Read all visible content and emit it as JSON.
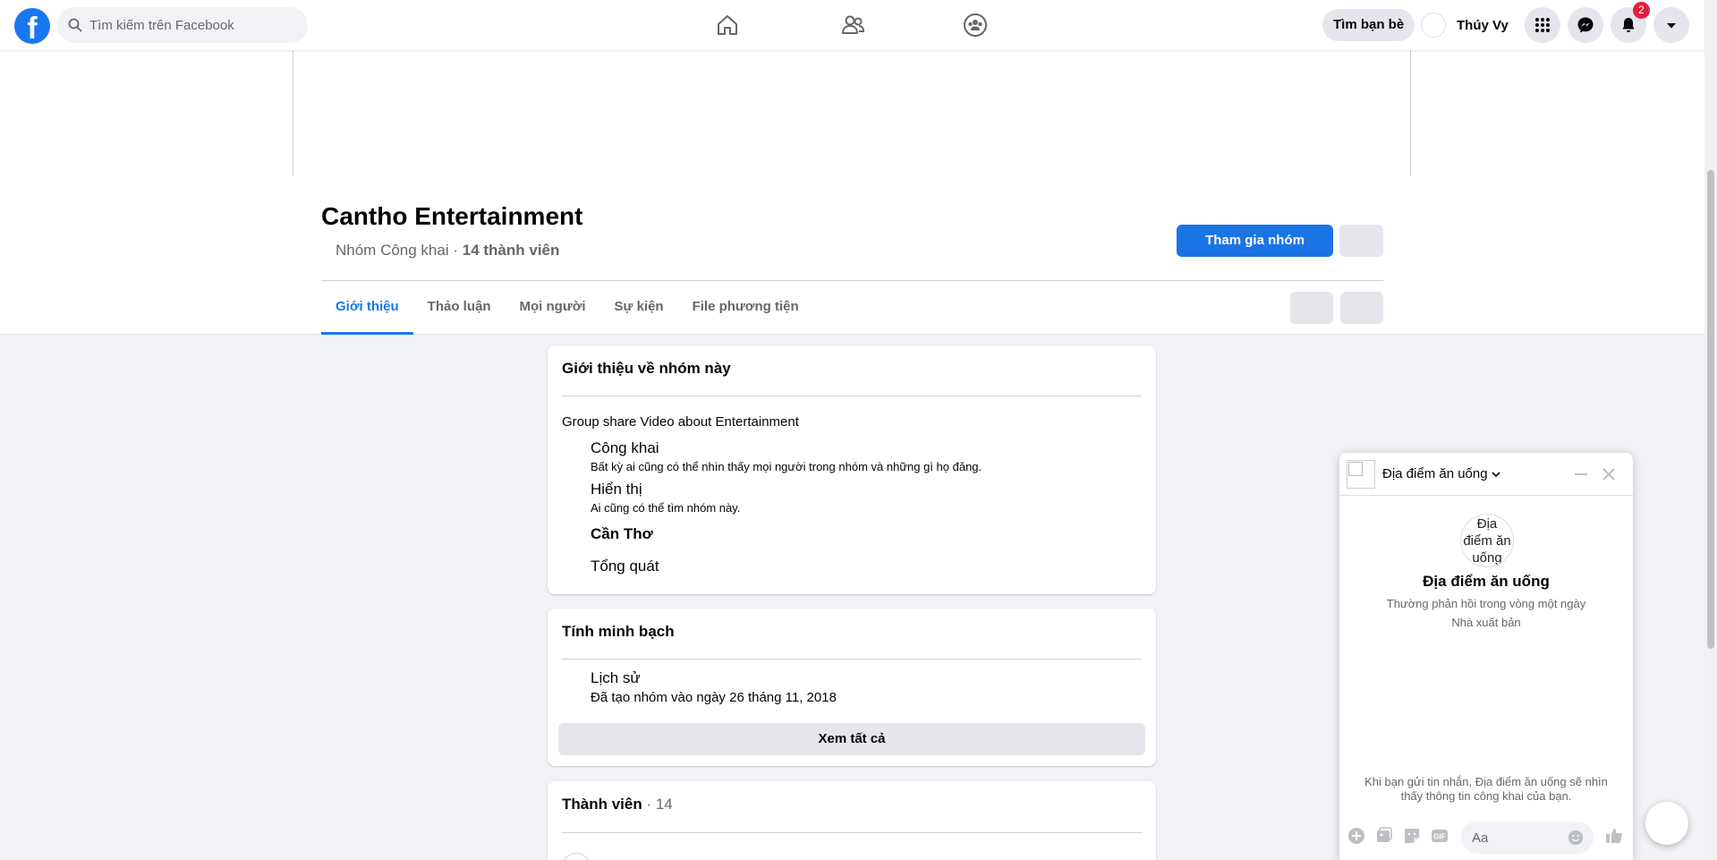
{
  "topbar": {
    "logo": "f",
    "search_placeholder": "Tìm kiếm trên Facebook",
    "find_friends": "Tìm bạn bè",
    "profile_name": "Thúy Vy",
    "notification_count": "2"
  },
  "group": {
    "title": "Cantho Entertainment",
    "privacy": "Nhóm Công khai",
    "dot": " · ",
    "members": "14 thành viên",
    "join_label": "Tham gia nhóm"
  },
  "tabs": [
    "Giới thiệu",
    "Thảo luận",
    "Mọi người",
    "Sự kiện",
    "File phương tiện"
  ],
  "about": {
    "heading": "Giới thiệu về nhóm này",
    "description": "Group share Video about Entertainment",
    "public_title": "Công khai",
    "public_desc": "Bất kỳ ai cũng có thể nhìn thấy mọi người trong nhóm và những gì họ đăng.",
    "visible_title": "Hiển thị",
    "visible_desc": "Ai cũng có thể tìm nhóm này.",
    "location": "Cần Thơ",
    "category": "Tổng quát"
  },
  "transparency": {
    "heading": "Tính minh bạch",
    "history_title": "Lịch sử",
    "history_desc": "Đã tạo nhóm vào ngày 26 tháng 11, 2018",
    "see_all": "Xem tất cả"
  },
  "members_card": {
    "heading": "Thành viên",
    "count": " · 14"
  },
  "chat": {
    "name": "Địa điểm ăn uống",
    "avatar_alt": "Địa điểm ăn uống",
    "title": "Địa điểm ăn uống",
    "response_time": "Thường phản hồi trong vòng một ngày",
    "role": "Nhà xuất bản",
    "notice": "Khi bạn gửi tin nhắn, Địa điểm ăn uống sẽ nhìn thấy thông tin công khai của bạn.",
    "input_placeholder": "Aa"
  }
}
